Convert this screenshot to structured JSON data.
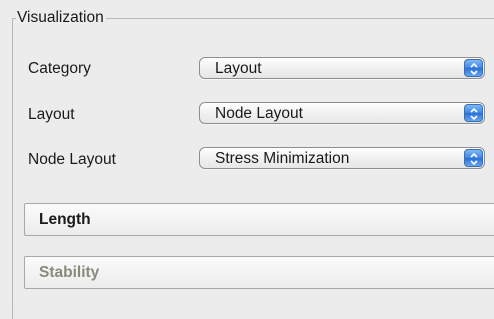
{
  "group": {
    "title": "Visualization"
  },
  "rows": [
    {
      "label": "Category",
      "value": "Layout"
    },
    {
      "label": "Layout",
      "value": "Node Layout"
    },
    {
      "label": "Node Layout",
      "value": "Stress Minimization"
    }
  ],
  "sections": [
    {
      "label": "Length",
      "enabled": true
    },
    {
      "label": "Stability",
      "enabled": false
    }
  ],
  "icons": {
    "combo_arrows": "up-down-chevron-icon"
  },
  "colors": {
    "combo_accent": "#3d86e4",
    "disabled_text": "#8a8a7c"
  }
}
